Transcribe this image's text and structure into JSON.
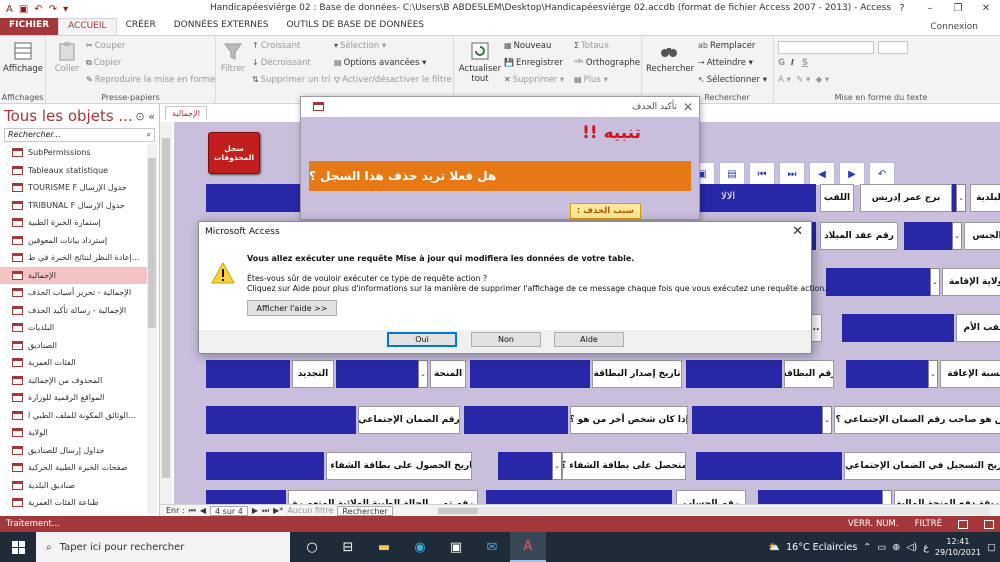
{
  "window": {
    "title": "Handicapéesviérge 02 : Base de données- C:\\Users\\B ABDESLEM\\Desktop\\Handicapéesviérge 02.accdb (format de fichier Access 2007 - 2013) - Access",
    "connexion": "Connexion"
  },
  "tabs": [
    "FICHIER",
    "ACCUEIL",
    "CRÉER",
    "DONNÉES EXTERNES",
    "OUTILS DE BASE DE DONNÉES"
  ],
  "ribbon": {
    "affichage": {
      "label": "Affichage",
      "group": "Affichages"
    },
    "presse": {
      "coller": "Coller",
      "couper": "Couper",
      "copier": "Copier",
      "reproduire": "Reproduire la mise en forme",
      "group": "Presse-papiers"
    },
    "tri": {
      "filtrer": "Filtrer",
      "croissant": "Croissant",
      "decroissant": "Décroissant",
      "supprimer_tri": "Supprimer un tri",
      "selection": "Sélection",
      "options": "Options avancées",
      "activer": "Activer/désactiver le filtre"
    },
    "enregistrements": {
      "actualiser": "Actualiser tout",
      "nouveau": "Nouveau",
      "enregistrer": "Enregistrer",
      "supprimer": "Supprimer",
      "totaux": "Totaux",
      "orthographe": "Orthographe",
      "plus": "Plus"
    },
    "rechercher": {
      "rechercher": "Rechercher",
      "remplacer": "Remplacer",
      "atteindre": "Atteindre",
      "selectionner": "Sélectionner",
      "group": "Rechercher"
    },
    "texte": {
      "group": "Mise en forme du texte"
    }
  },
  "nav": {
    "title": "Tous les objets ...",
    "search_placeholder": "Rechercher...",
    "items": [
      "SubPermissions",
      "Tableaux statistique",
      "TOURISME F جدول الإرسال",
      "TRIBUNAL F جدول الإرسال",
      "إستمارة الخبرة الطبية",
      "إسترداد بيانات المعوقين",
      "إعادة النظر لنتائج الخبرة في ط...",
      "الإجمالية",
      "الإجمالية - تحرير أسباب الحذف",
      "الإجمالية - رسالة تأكيد الحذف",
      "البلديات",
      "الصناديق",
      "الفئات العمرية",
      "المحذوف من الإجمالية",
      "المواقع الرقمية للوزارة",
      "الوثائق المكونة للملف الطبي ا...",
      "الولاية",
      "جداول إرسال للصناديق",
      "صفحات الخبرة الطبية الحركية",
      "صناديق البلدية",
      "طباعة الفئات العمرية"
    ],
    "selected_index": 7
  },
  "doc": {
    "tab": "الإجمالية",
    "red_button": "سجل المحذوفات",
    "labels": {
      "baladiya": "البلدية",
      "nom": "اللقب",
      "nom_value": "الالا",
      "prenom_value": "برج عمر إدريس",
      "acte": "رقم عقد الميلاد",
      "sexe": "الجنس",
      "residence": "ولاية الإقامة",
      "mere": "لقب الأم",
      "handicap": "نسبة الإعاقة",
      "carte": "رقم البطاقة",
      "date_carte": "تاريخ إصدار البطاقة",
      "minha": "المنحة",
      "tajdid": "التجديد",
      "sahib": "من هو صاحب رقم الضمان الإجتماعي ؟",
      "shakhs": "إذا كان شخص أخر من هو ؟",
      "raqm_daman": "رقم الضمان الإجتماعي",
      "tasjil": "تاريخ التسجيل في الضمان الإجتماعي",
      "tahassal": "متحصل على بطاقة الشفاء ؟",
      "tarikh_shifa": "تاريخ الحصول على بطاقة الشفاء ؟",
      "hisab": "رقم الحساب",
      "tariqa": "طريقة دفع المنحة المالية",
      "shifa_bottom": "رقم تم ...الحالة الطبية الولائية المتعم رة"
    }
  },
  "records": {
    "label": "Enr : ",
    "position": "4 sur 4",
    "filter": "Aucun filtre",
    "search": "Rechercher"
  },
  "status": {
    "left": "Traitement...",
    "verr": "VERR. NUM.",
    "filtre": "FILTRÉ"
  },
  "taskbar": {
    "search": "Taper ici pour rechercher",
    "weather": "16°C Eclaircies",
    "lang": "ع",
    "time": "12:41",
    "date": "29/10/2021"
  },
  "dialog_confirm": {
    "title": "تأكيد الحذف",
    "warning": "تنبيه !!",
    "question": "هل فعلا تريد حذف هذا السجل ؟",
    "reason": "سبب الحذف :"
  },
  "dialog_access": {
    "title": "Microsoft Access",
    "msg1": "Vous allez exécuter une requête Mise à jour qui modifiera les données de votre table.",
    "msg2": "Êtes-vous sûr de vouloir exécuter ce type de requête action ?",
    "msg3": "Cliquez sur Aide pour plus d'informations sur la manière de supprimer l'affichage de ce message chaque fois que vous exécutez une requête action.",
    "help_button": "Afficher l'aide >>",
    "oui": "Oui",
    "non": "Non",
    "aide": "Aide"
  },
  "colors": {
    "access_red": "#a4373a",
    "form_bg": "#c9bfdd",
    "field_blue": "#2727a8",
    "orange": "#e67816"
  }
}
